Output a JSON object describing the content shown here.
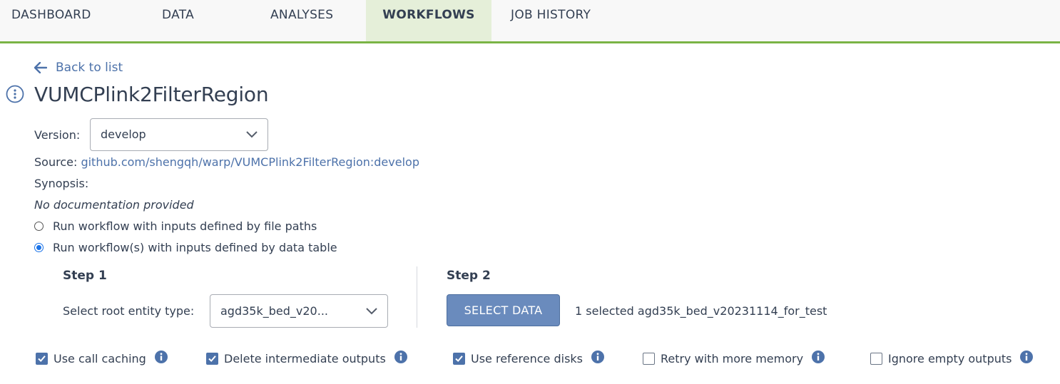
{
  "nav": {
    "tabs": [
      {
        "label": "DASHBOARD",
        "active": false
      },
      {
        "label": "DATA",
        "active": false
      },
      {
        "label": "ANALYSES",
        "active": false
      },
      {
        "label": "WORKFLOWS",
        "active": true
      },
      {
        "label": "JOB HISTORY",
        "active": false
      }
    ]
  },
  "back_link": {
    "label": "Back to list",
    "icon": "arrow-left-icon"
  },
  "workflow": {
    "info_icon": "kebab-circle-icon",
    "title": "VUMCPlink2FilterRegion",
    "version_label": "Version:",
    "version_value": "develop",
    "source_label": "Source:",
    "source_link": "github.com/shengqh/warp/VUMCPlink2FilterRegion:develop",
    "synopsis_label": "Synopsis:",
    "synopsis_value": "No documentation provided"
  },
  "run_options": [
    {
      "label": "Run workflow with inputs defined by file paths",
      "selected": false
    },
    {
      "label": "Run workflow(s) with inputs defined by data table",
      "selected": true
    }
  ],
  "step1": {
    "title": "Step 1",
    "label": "Select root entity type:",
    "value": "agd35k_bed_v20..."
  },
  "step2": {
    "title": "Step 2",
    "button": "SELECT DATA",
    "selection_text": "1 selected agd35k_bed_v20231114_for_test"
  },
  "options": [
    {
      "label": "Use call caching",
      "checked": true
    },
    {
      "label": "Delete intermediate outputs",
      "checked": true
    },
    {
      "label": "Use reference disks",
      "checked": true
    },
    {
      "label": "Retry with more memory",
      "checked": false
    },
    {
      "label": "Ignore empty outputs",
      "checked": false
    }
  ],
  "colors": {
    "accent_green": "#7ab445",
    "link_blue": "#4d72aa",
    "button_blue": "#6a8bbd"
  }
}
